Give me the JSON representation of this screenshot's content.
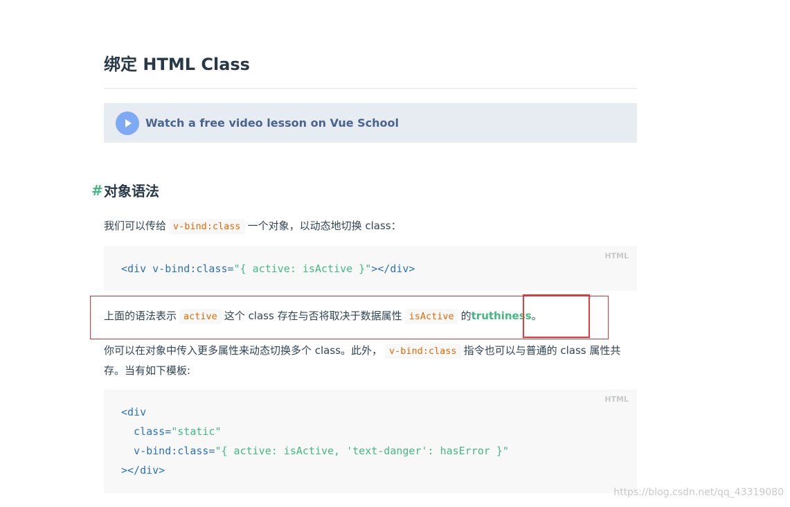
{
  "heading": {
    "zh": "绑定",
    "en": "HTML Class"
  },
  "vue_school": {
    "text": "Watch a free video lesson on Vue School",
    "icon": "play-icon"
  },
  "section": {
    "hash": "#",
    "title": "对象语法"
  },
  "para1": {
    "before": "我们可以传给",
    "code": "v-bind:class",
    "after": "一个对象，以动态地切换 class："
  },
  "code1": {
    "lang": "HTML",
    "tag_open": "<div",
    "attr": " v-bind:class=",
    "value": "\"{ active: isActive }\"",
    "tag_close": "></div>"
  },
  "para2": {
    "t1": "上面的语法表示",
    "code1": "active",
    "t2": "这个 class 存在与否将取决于数据属性",
    "code2": "isActive",
    "t3": "的",
    "link": "truthiness",
    "t4": "。"
  },
  "para3": {
    "t1": "你可以在对象中传入更多属性来动态切换多个 class。此外，",
    "code": "v-bind:class",
    "t2": "指令也可以与普通的 class 属性共存。当有如下模板:"
  },
  "code2": {
    "lang": "HTML",
    "l1": "<div",
    "l2_attr": "  class=",
    "l2_val": "\"static\"",
    "l3_attr": "  v-bind:class=",
    "l3_val": "\"{ active: isActive, 'text-danger': hasError }\"",
    "l4": "></div>"
  },
  "watermark": "https://blog.csdn.net/qq_43319080",
  "colors": {
    "accent": "#42b983",
    "highlight_border": "#e23b3b"
  }
}
